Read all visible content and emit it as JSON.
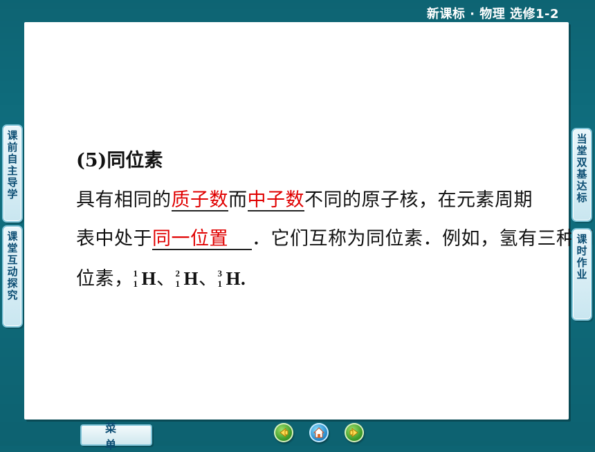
{
  "header": {
    "title": "新课标 · 物理    选修1-2"
  },
  "left_tabs": [
    {
      "label": "课前自主导学"
    },
    {
      "label": "课堂互动探究"
    }
  ],
  "right_tabs": [
    {
      "label": "当堂双基达标"
    },
    {
      "label": "课时作业"
    }
  ],
  "content": {
    "heading": "(5)同位素",
    "line1": {
      "pre": "具有相同的",
      "blank1": "质子数",
      "mid": "而",
      "blank2": "中子数",
      "post": "不同的原子核，在元素周期"
    },
    "line2": {
      "pre": "表中处于",
      "blank3": "同一位置",
      "post": "．它们互称为同位素．例如，氢有三种同"
    },
    "line3": {
      "pre": "位素，",
      "isotopes": [
        {
          "mass": "1",
          "atomic": "1",
          "symbol": "H"
        },
        {
          "mass": "2",
          "atomic": "1",
          "symbol": "H"
        },
        {
          "mass": "3",
          "atomic": "1",
          "symbol": "H"
        }
      ],
      "sep": "、",
      "end": "."
    }
  },
  "footer": {
    "menu_label": "菜单",
    "nav_icons": [
      "previous-icon",
      "home-icon",
      "next-icon"
    ]
  },
  "colors": {
    "background": "#0f6f80",
    "answer_text": "#e00000",
    "tab_text": "#0b4d73"
  }
}
